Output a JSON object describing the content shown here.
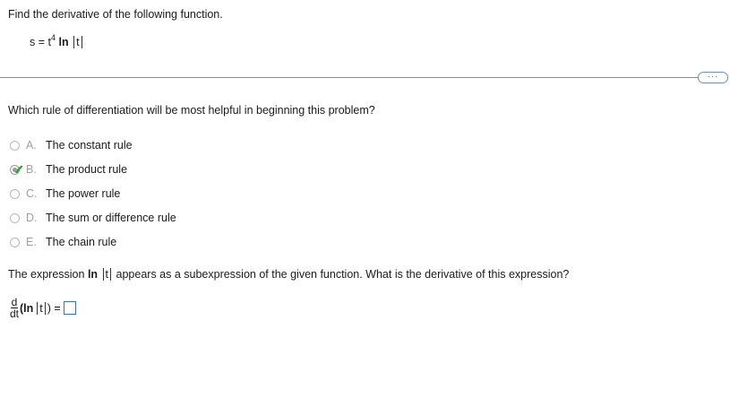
{
  "problem": {
    "prompt": "Find the derivative of the following function.",
    "function": {
      "lhs": "s = t",
      "exponent": "4",
      "ln": "ln",
      "var": "t"
    }
  },
  "more_button": {
    "label": "···"
  },
  "part1": {
    "question": "Which rule of differentiation will be most helpful in beginning this problem?",
    "options": [
      {
        "letter": "A.",
        "text": "The constant rule",
        "selected": false
      },
      {
        "letter": "B.",
        "text": "The product rule",
        "selected": true,
        "correct": true
      },
      {
        "letter": "C.",
        "text": "The power rule",
        "selected": false
      },
      {
        "letter": "D.",
        "text": "The sum or difference rule",
        "selected": false
      },
      {
        "letter": "E.",
        "text": "The chain rule",
        "selected": false
      }
    ]
  },
  "part2": {
    "question_pre": "The expression",
    "question_ln": "ln",
    "question_var": "t",
    "question_post": "appears as a subexpression of the given function. What is the derivative of this expression?",
    "deriv_num": "d",
    "deriv_den": "dt",
    "deriv_open": "(ln",
    "deriv_var": "t",
    "deriv_close": ") =",
    "answer_value": ""
  },
  "colors": {
    "check": "#2aa52a",
    "answer_box_border": "#3a70c0",
    "letter_gray": "#a0a0a0"
  }
}
